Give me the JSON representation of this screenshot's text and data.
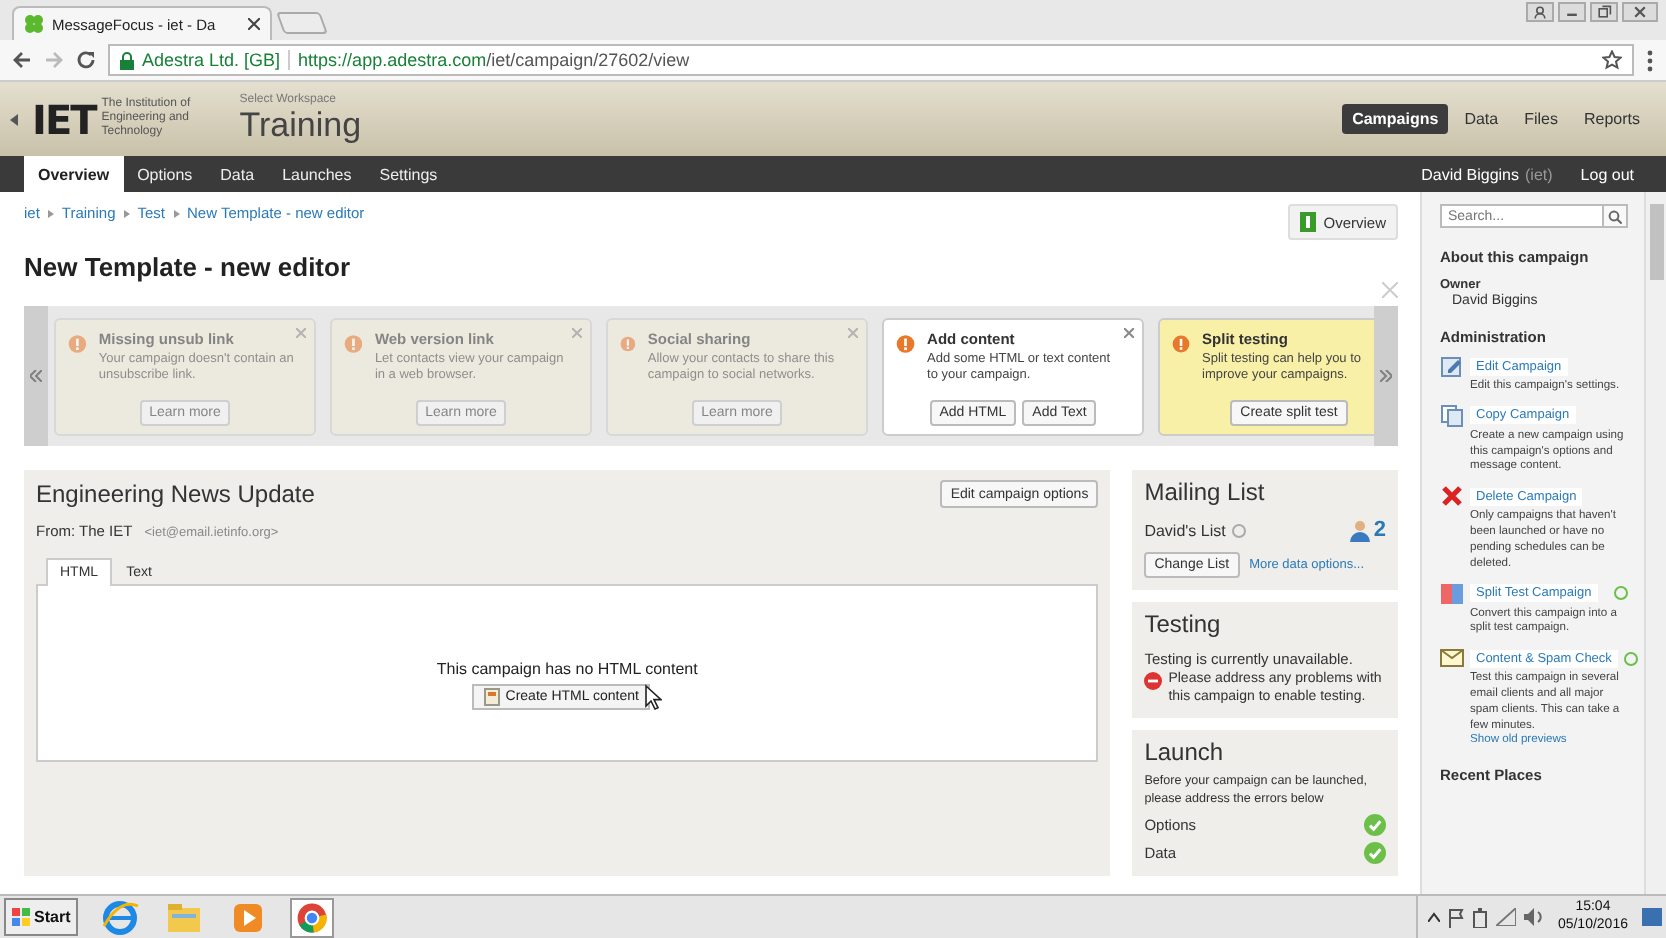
{
  "browser": {
    "tab_title": "MessageFocus - iet - Da",
    "site_identity": "Adestra Ltd. [GB]",
    "url_host": "https://app.adestra.com",
    "url_path": "/iet/campaign/27602/view"
  },
  "header": {
    "logo_text": "IET",
    "logo_caption": "The Institution of Engineering and Technology",
    "workspace_label": "Select Workspace",
    "workspace": "Training",
    "nav": [
      {
        "label": "Campaigns",
        "selected": true
      },
      {
        "label": "Data",
        "selected": false
      },
      {
        "label": "Files",
        "selected": false
      },
      {
        "label": "Reports",
        "selected": false
      }
    ]
  },
  "menu": {
    "items": [
      {
        "label": "Overview",
        "selected": true
      },
      {
        "label": "Options",
        "selected": false
      },
      {
        "label": "Data",
        "selected": false
      },
      {
        "label": "Launches",
        "selected": false
      },
      {
        "label": "Settings",
        "selected": false
      }
    ],
    "user": "David Biggins",
    "user_org": "(iet)",
    "logout": "Log out"
  },
  "breadcrumb": [
    "iet",
    "Training",
    "Test",
    "New Template - new editor"
  ],
  "page_title": "New Template - new editor",
  "overview_button": "Overview",
  "cards": [
    {
      "kind": "faded",
      "title": "Missing unsub link",
      "text": "Your campaign doesn't contain an unsubscribe link.",
      "buttons": [
        "Learn more"
      ]
    },
    {
      "kind": "faded",
      "title": "Web version link",
      "text": "Let contacts view your campaign in a web browser.",
      "buttons": [
        "Learn more"
      ]
    },
    {
      "kind": "faded",
      "title": "Social sharing",
      "text": "Allow your contacts to share this campaign to social networks.",
      "buttons": [
        "Learn more"
      ]
    },
    {
      "kind": "normal",
      "title": "Add content",
      "text": "Add some HTML or text content to your campaign.",
      "buttons": [
        "Add HTML",
        "Add Text"
      ]
    },
    {
      "kind": "highlight",
      "title": "Split testing",
      "text": "Split testing can help you to improve your campaigns.",
      "buttons": [
        "Create split test"
      ]
    }
  ],
  "campaign": {
    "name": "Engineering News Update",
    "from_label": "From: The IET",
    "from_email": "<iet@email.ietinfo.org>",
    "edit_button": "Edit campaign options",
    "tabs": [
      {
        "label": "HTML",
        "selected": true
      },
      {
        "label": "Text",
        "selected": false
      }
    ],
    "empty_message": "This campaign has no HTML content",
    "create_button": "Create HTML content"
  },
  "mailing_list": {
    "title": "Mailing List",
    "list_name": "David's List",
    "count": "2",
    "change_button": "Change List",
    "more_link": "More data options..."
  },
  "testing": {
    "title": "Testing",
    "status": "Testing is currently unavailable.",
    "error": "Please address any problems with this campaign to enable testing."
  },
  "launch": {
    "title": "Launch",
    "text": "Before your campaign can be launched, please address the errors below",
    "checks": [
      {
        "label": "Options",
        "ok": true
      },
      {
        "label": "Data",
        "ok": true
      }
    ]
  },
  "sidebar": {
    "search_placeholder": "Search...",
    "about_title": "About this campaign",
    "owner_label": "Owner",
    "owner": "David Biggins",
    "admin_title": "Administration",
    "actions": [
      {
        "kind": "edit",
        "label": "Edit Campaign",
        "text": "Edit this campaign's settings.",
        "info": false
      },
      {
        "kind": "copy",
        "label": "Copy Campaign",
        "text": "Create a new campaign using this campaign's options and message content.",
        "info": false
      },
      {
        "kind": "delete",
        "label": "Delete Campaign",
        "text": "Only campaigns that haven't been launched or have no pending schedules can be deleted.",
        "info": false
      },
      {
        "kind": "split",
        "label": "Split Test Campaign",
        "text": "Convert this campaign into a split test campaign.",
        "info": true
      },
      {
        "kind": "spam",
        "label": "Content & Spam Check",
        "text": "Test this campaign in several email clients and all major spam clients. This can take a few minutes.",
        "info": true,
        "link": "Show old previews"
      }
    ],
    "recent_title": "Recent Places"
  },
  "taskbar": {
    "start": "Start",
    "apps": [
      {
        "kind": "ie",
        "selected": false
      },
      {
        "kind": "folder",
        "selected": false
      },
      {
        "kind": "media",
        "selected": false
      },
      {
        "kind": "chrome",
        "selected": true
      }
    ],
    "time": "15:04",
    "date": "05/10/2016"
  }
}
